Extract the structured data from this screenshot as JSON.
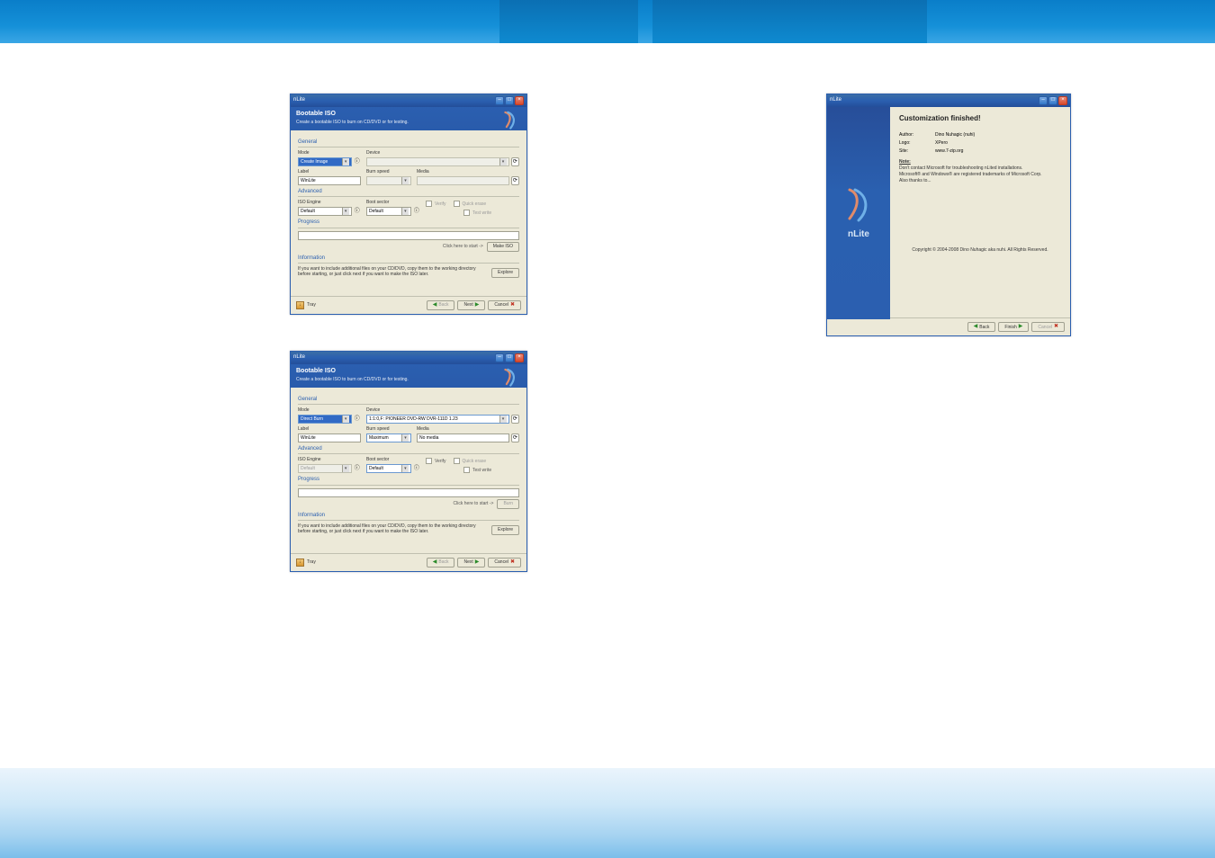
{
  "windowA": {
    "title": "nLite",
    "header_title": "Bootable ISO",
    "header_sub": "Create a bootable ISO to burn on CD/DVD or for testing.",
    "general": "General",
    "mode": "Mode",
    "mode_value": "Create Image",
    "device": "Device",
    "device_value": "",
    "label": "Label",
    "label_value": "WinLite",
    "burn_speed": "Burn speed",
    "burn_speed_value": "",
    "media": "Media",
    "media_value": "",
    "advanced": "Advanced",
    "iso_engine": "ISO Engine",
    "iso_engine_value": "Default",
    "boot_sector": "Boot sector",
    "boot_sector_value": "Default",
    "quick_erase": "Quick erase",
    "verify": "Verify",
    "test_write": "Test write",
    "progress": "Progress",
    "click_here": "Click here to start ->",
    "make_iso": "Make ISO",
    "information": "Information",
    "info_text": "If you want to include additional files on your CD/DVD, copy them to the working directory before starting, or just click next if you want to make the ISO later.",
    "explore": "Explore",
    "tray": "Tray",
    "back": "Back",
    "next": "Next",
    "cancel": "Cancel"
  },
  "windowB": {
    "title": "nLite",
    "header_title": "Bootable ISO",
    "header_sub": "Create a bootable ISO to burn on CD/DVD or for testing.",
    "general": "General",
    "mode": "Mode",
    "mode_value": "Direct Burn",
    "device": "Device",
    "device_value": "1:1:0,F: PIONEER DVD-RW DVR-111D 1.23",
    "label": "Label",
    "label_value": "WinLite",
    "burn_speed": "Burn speed",
    "burn_speed_value": "Maximum",
    "media": "Media",
    "media_value": "No media",
    "advanced": "Advanced",
    "iso_engine": "ISO Engine",
    "iso_engine_value": "Default",
    "boot_sector": "Boot sector",
    "boot_sector_value": "Default",
    "quick_erase": "Quick erase",
    "verify": "Verify",
    "test_write": "Test write",
    "progress": "Progress",
    "click_here": "Click here to start ->",
    "burn": "Burn",
    "information": "Information",
    "info_text": "If you want to include additional files on your CD/DVD, copy them to the working directory before starting, or just click next if you want to make the ISO later.",
    "explore": "Explore",
    "tray": "Tray",
    "back": "Back",
    "next": "Next",
    "cancel": "Cancel"
  },
  "windowC": {
    "title": "nLite",
    "heading": "Customization finished!",
    "author_k": "Author:",
    "author_v": "Dino Nuhagic (nuhi)",
    "logo_k": "Logo:",
    "logo_v": "XPero",
    "site_k": "Site:",
    "site_v": "www.7-zip.org",
    "note_label": "Note:",
    "note_text1": "Don't contact Microsoft for troubleshooting nLited installations.",
    "note_text2": "Microsoft® and Windows® are registered trademarks of Microsoft Corp.",
    "note_text3": "Also thanks to...",
    "copyright": "Copyright © 2004-2008 Dino Nuhagic aka nuhi. All Rights Reserved.",
    "back": "Back",
    "finish": "Finish",
    "cancel": "Cancel",
    "brand": "nLite"
  }
}
